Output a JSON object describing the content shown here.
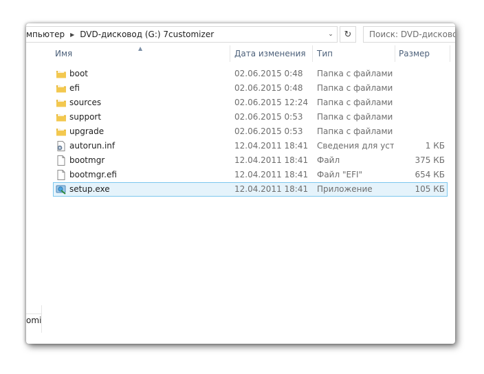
{
  "address": {
    "crumbs": [
      "мпьютер",
      "DVD-дисковод (G:) 7customizer"
    ]
  },
  "search": {
    "placeholder": "Поиск: DVD-дисковод (G:)"
  },
  "columns": {
    "name": "Имя",
    "date": "Дата изменения",
    "type": "Тип",
    "size": "Размер"
  },
  "files": [
    {
      "name": "boot",
      "date": "02.06.2015 0:48",
      "type": "Папка с файлами",
      "size": "",
      "icon": "folder-icon"
    },
    {
      "name": "efi",
      "date": "02.06.2015 0:48",
      "type": "Папка с файлами",
      "size": "",
      "icon": "folder-icon"
    },
    {
      "name": "sources",
      "date": "02.06.2015 12:24",
      "type": "Папка с файлами",
      "size": "",
      "icon": "folder-icon"
    },
    {
      "name": "support",
      "date": "02.06.2015 0:53",
      "type": "Папка с файлами",
      "size": "",
      "icon": "folder-icon"
    },
    {
      "name": "upgrade",
      "date": "02.06.2015 0:53",
      "type": "Папка с файлами",
      "size": "",
      "icon": "folder-icon"
    },
    {
      "name": "autorun.inf",
      "date": "12.04.2011 18:41",
      "type": "Сведения для уст...",
      "size": "1 КБ",
      "icon": "settings-file-icon"
    },
    {
      "name": "bootmgr",
      "date": "12.04.2011 18:41",
      "type": "Файл",
      "size": "375 КБ",
      "icon": "file-icon"
    },
    {
      "name": "bootmgr.efi",
      "date": "12.04.2011 18:41",
      "type": "Файл \"EFI\"",
      "size": "654 КБ",
      "icon": "file-icon"
    },
    {
      "name": "setup.exe",
      "date": "12.04.2011 18:41",
      "type": "Приложение",
      "size": "105 КБ",
      "icon": "setup-exe-icon"
    }
  ],
  "selected_index": 8,
  "nav_stub": {
    "label": "оmi"
  }
}
